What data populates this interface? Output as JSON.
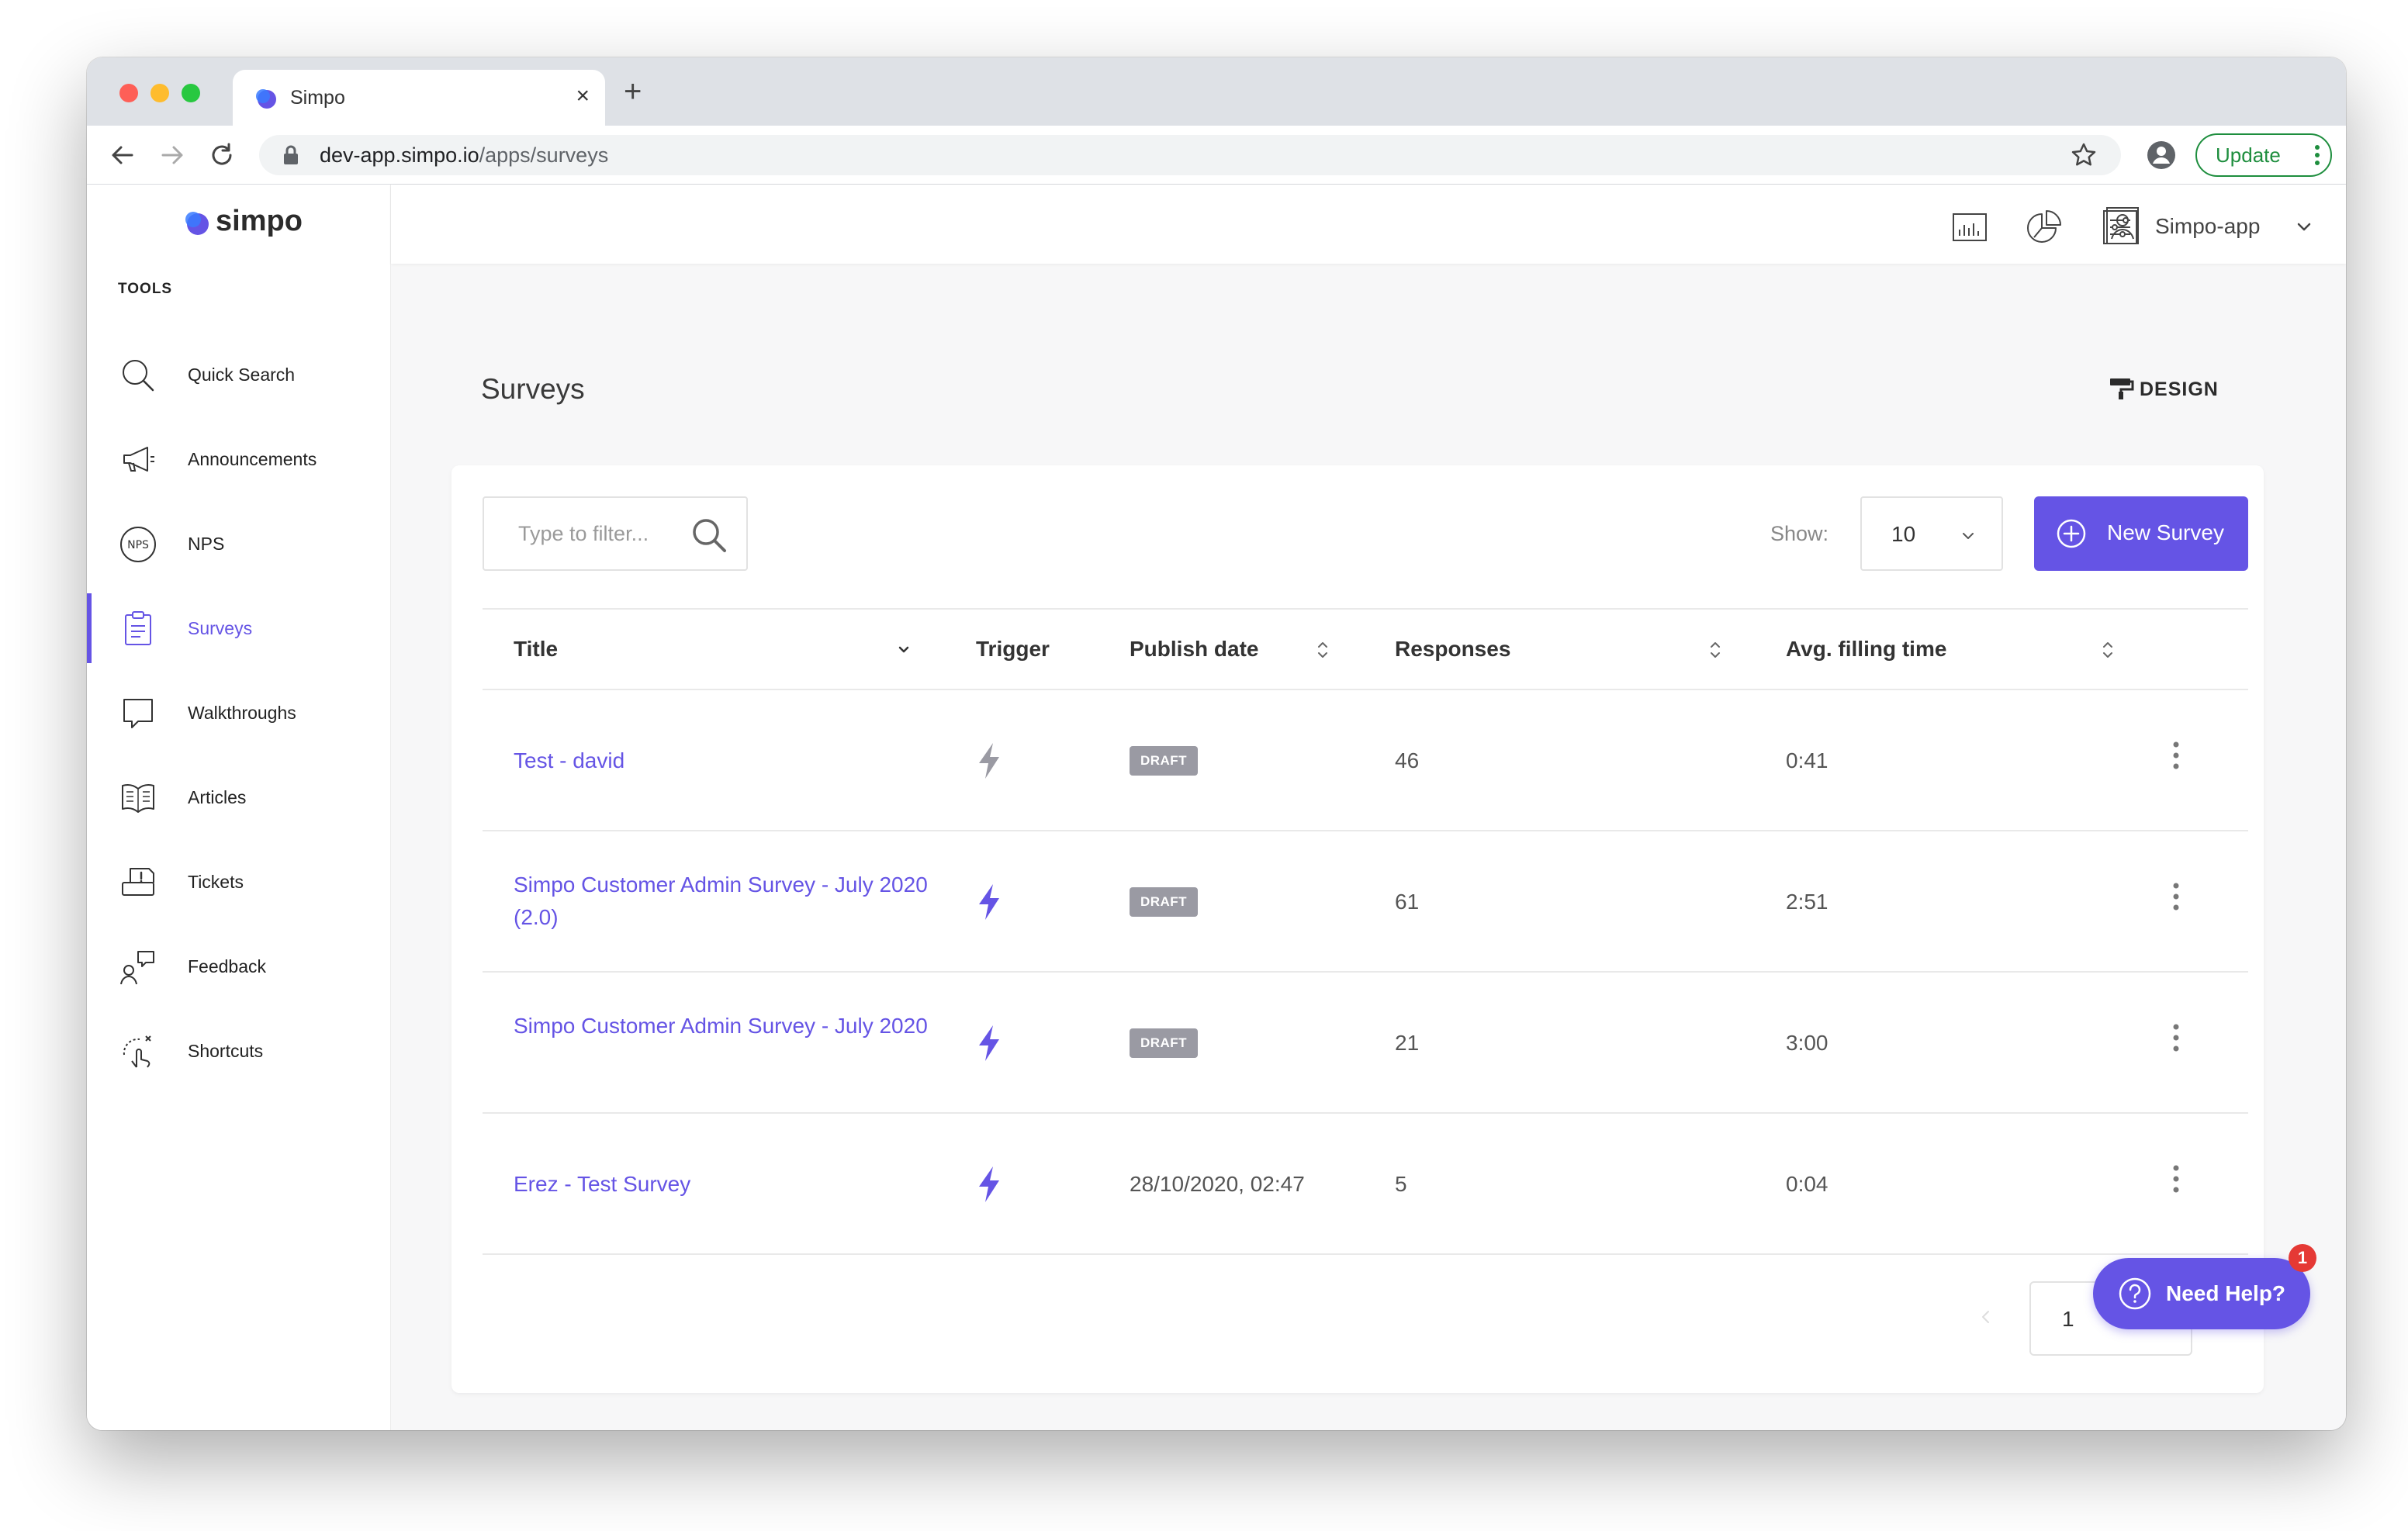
{
  "browser": {
    "tab_title": "Simpo",
    "url_host": "dev-app.simpo.io",
    "url_path": "/apps/surveys",
    "update_label": "Update"
  },
  "sidebar": {
    "logo": "simpo",
    "section_label": "TOOLS",
    "items": [
      {
        "label": "Quick Search",
        "icon": "search-icon"
      },
      {
        "label": "Announcements",
        "icon": "megaphone-icon"
      },
      {
        "label": "NPS",
        "icon": "nps-icon"
      },
      {
        "label": "Surveys",
        "icon": "clipboard-icon",
        "active": true
      },
      {
        "label": "Walkthroughs",
        "icon": "speech-bubble-icon"
      },
      {
        "label": "Articles",
        "icon": "book-icon"
      },
      {
        "label": "Tickets",
        "icon": "ticket-icon"
      },
      {
        "label": "Feedback",
        "icon": "feedback-icon"
      },
      {
        "label": "Shortcuts",
        "icon": "tap-gesture-icon"
      }
    ]
  },
  "topbar": {
    "account_name": "Simpo-app"
  },
  "page": {
    "title": "Surveys",
    "design_label": "DESIGN"
  },
  "toolbar": {
    "filter_placeholder": "Type to filter...",
    "show_label": "Show:",
    "show_value": "10",
    "new_survey_label": "New Survey"
  },
  "table": {
    "columns": [
      "Title",
      "Trigger",
      "Publish date",
      "Responses",
      "Avg. filling time"
    ],
    "rows": [
      {
        "title": "Test - david",
        "status": "DRAFT",
        "publish_date": "",
        "responses": "46",
        "avg_time": "0:41"
      },
      {
        "title": "Simpo Customer Admin Survey - July 2020 (2.0)",
        "status": "DRAFT",
        "publish_date": "",
        "responses": "61",
        "avg_time": "2:51"
      },
      {
        "title": "Simpo Customer Admin Survey - July 2020",
        "status": "DRAFT",
        "publish_date": "",
        "responses": "21",
        "avg_time": "3:00"
      },
      {
        "title": "Erez - Test Survey",
        "status": "",
        "publish_date": "28/10/2020, 02:47",
        "responses": "5",
        "avg_time": "0:04"
      }
    ]
  },
  "pagination": {
    "current_page": "1"
  },
  "help": {
    "label": "Need Help?",
    "badge_count": "1"
  },
  "colors": {
    "accent": "#6554e5",
    "draft_badge": "#9a9aa3",
    "update_green": "#1e8e3e"
  }
}
